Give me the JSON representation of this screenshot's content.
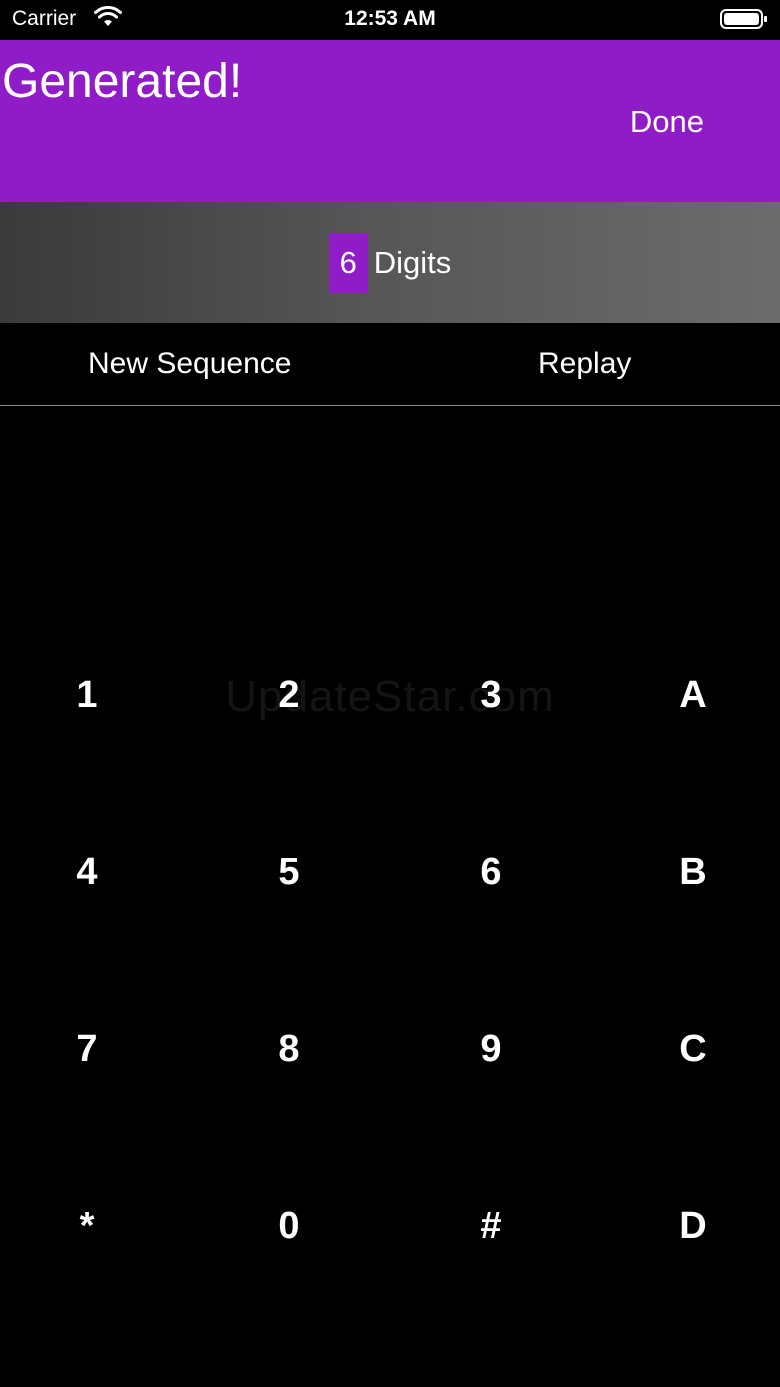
{
  "status_bar": {
    "carrier": "Carrier",
    "time": "12:53 AM",
    "wifi_icon": "wifi-icon",
    "battery_icon": "battery-icon"
  },
  "header": {
    "title": "Generated!",
    "done_label": "Done",
    "color": "#8f1cc6"
  },
  "digits": {
    "count": "6",
    "label": "Digits"
  },
  "actions": {
    "new_sequence": "New Sequence",
    "replay": "Replay"
  },
  "watermark": "UpdateStar.com",
  "keypad": {
    "keys": [
      "1",
      "2",
      "3",
      "A",
      "4",
      "5",
      "6",
      "B",
      "7",
      "8",
      "9",
      "C",
      "*",
      "0",
      "#",
      "D"
    ]
  }
}
